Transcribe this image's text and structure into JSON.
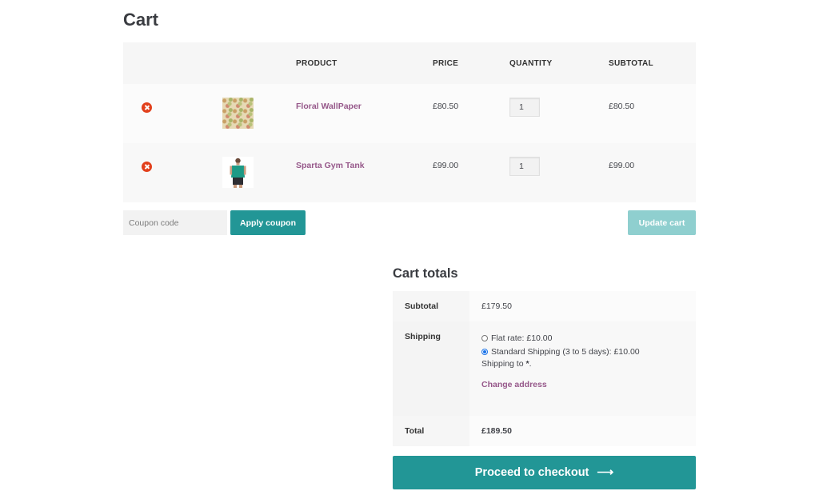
{
  "page": {
    "title": "Cart"
  },
  "cart_table": {
    "headers": {
      "product": "PRODUCT",
      "price": "PRICE",
      "quantity": "QUANTITY",
      "subtotal": "SUBTOTAL"
    },
    "items": [
      {
        "name": "Floral WallPaper",
        "price": "£80.50",
        "quantity": "1",
        "subtotal": "£80.50",
        "thumb": "floral"
      },
      {
        "name": "Sparta Gym Tank",
        "price": "£99.00",
        "quantity": "1",
        "subtotal": "£99.00",
        "thumb": "tank"
      }
    ]
  },
  "coupon": {
    "placeholder": "Coupon code",
    "apply_label": "Apply coupon",
    "update_label": "Update cart"
  },
  "totals": {
    "title": "Cart totals",
    "subtotal_label": "Subtotal",
    "subtotal_value": "£179.50",
    "shipping_label": "Shipping",
    "shipping_options": [
      {
        "label": "Flat rate: £10.00",
        "selected": false
      },
      {
        "label": "Standard Shipping (3 to 5 days): £10.00",
        "selected": true
      }
    ],
    "shipping_dest_prefix": "Shipping to ",
    "shipping_dest": "*",
    "shipping_dest_suffix": ".",
    "change_address": "Change address",
    "total_label": "Total",
    "total_value": "£189.50"
  },
  "checkout": {
    "label": "Proceed to checkout",
    "arrow": "⟶"
  },
  "colors": {
    "accent": "#229696",
    "accent_light": "#8fcfcf",
    "link": "#96588a",
    "remove": "#e2401c"
  }
}
